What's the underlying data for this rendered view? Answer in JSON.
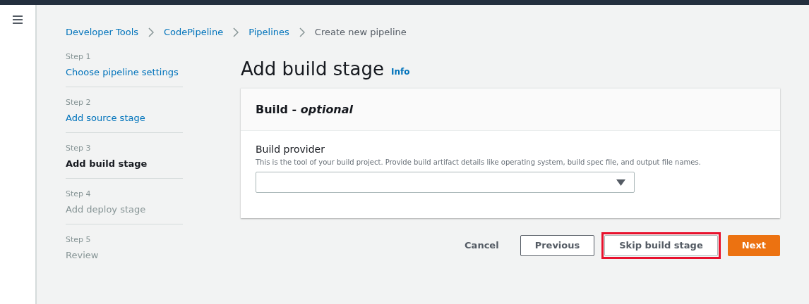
{
  "breadcrumbs": [
    {
      "label": "Developer Tools",
      "kind": "link"
    },
    {
      "label": "CodePipeline",
      "kind": "link"
    },
    {
      "label": "Pipelines",
      "kind": "link"
    },
    {
      "label": "Create new pipeline",
      "kind": "current"
    }
  ],
  "steps": [
    {
      "step": "Step 1",
      "label": "Choose pipeline settings",
      "kind": "done"
    },
    {
      "step": "Step 2",
      "label": "Add source stage",
      "kind": "done"
    },
    {
      "step": "Step 3",
      "label": "Add build stage",
      "kind": "current"
    },
    {
      "step": "Step 4",
      "label": "Add deploy stage",
      "kind": "upcoming"
    },
    {
      "step": "Step 5",
      "label": "Review",
      "kind": "upcoming"
    }
  ],
  "heading": {
    "title": "Add build stage",
    "info": "Info"
  },
  "card": {
    "title": "Build - *optional*",
    "field": {
      "label": "Build provider",
      "description": "This is the tool of your build project. Provide build artifact details like operating system, build spec file, and output file names."
    }
  },
  "buttons": [
    {
      "label": "Cancel",
      "kind": "link",
      "highlighted": false
    },
    {
      "label": "Previous",
      "kind": "normal",
      "highlighted": false
    },
    {
      "label": "Skip build stage",
      "kind": "normal",
      "highlighted": true
    },
    {
      "label": "Next",
      "kind": "primary",
      "highlighted": false
    }
  ]
}
